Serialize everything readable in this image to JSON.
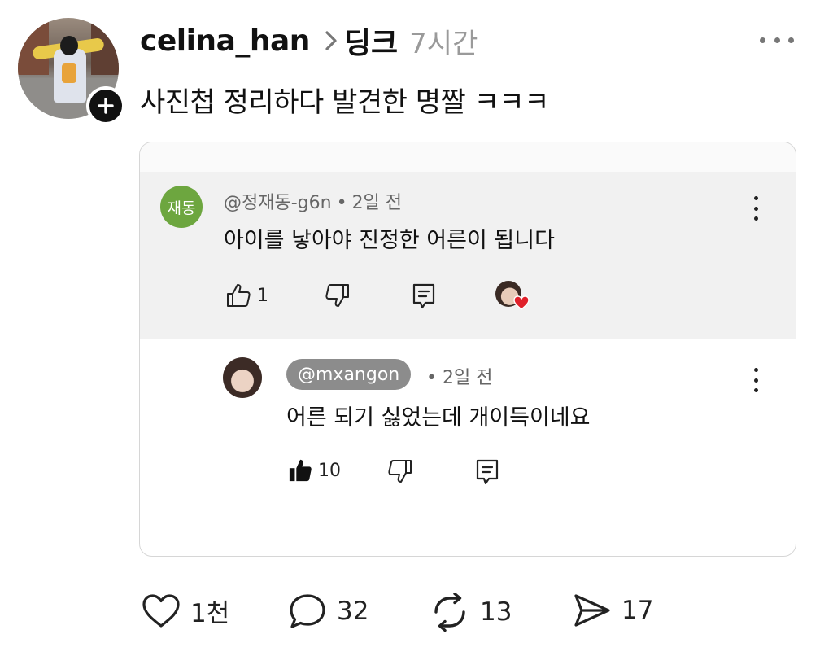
{
  "post": {
    "username": "celina_han",
    "topic": "딩크",
    "time": "7시간",
    "caption": "사진첩 정리하다 발견한 명짤 ㅋㅋㅋ"
  },
  "embedded": {
    "comment": {
      "avatar_text": "재동",
      "author": "@정재동-g6n",
      "separator": "•",
      "when": "2일 전",
      "text": "아이를 낳아야 진정한 어른이 됩니다",
      "like_count": "1"
    },
    "reply": {
      "author": "@mxangon",
      "separator": "•",
      "when": "2일 전",
      "text": "어른 되기 싫었는데 개이득이네요",
      "like_count": "10"
    }
  },
  "actions": {
    "likes": "1천",
    "comments": "32",
    "reposts": "13",
    "shares": "17"
  },
  "colors": {
    "avatar_green": "#6da63f",
    "mention_bg": "#8c8c8c",
    "muted": "#9a9a9a",
    "heart": "#e0202a"
  }
}
